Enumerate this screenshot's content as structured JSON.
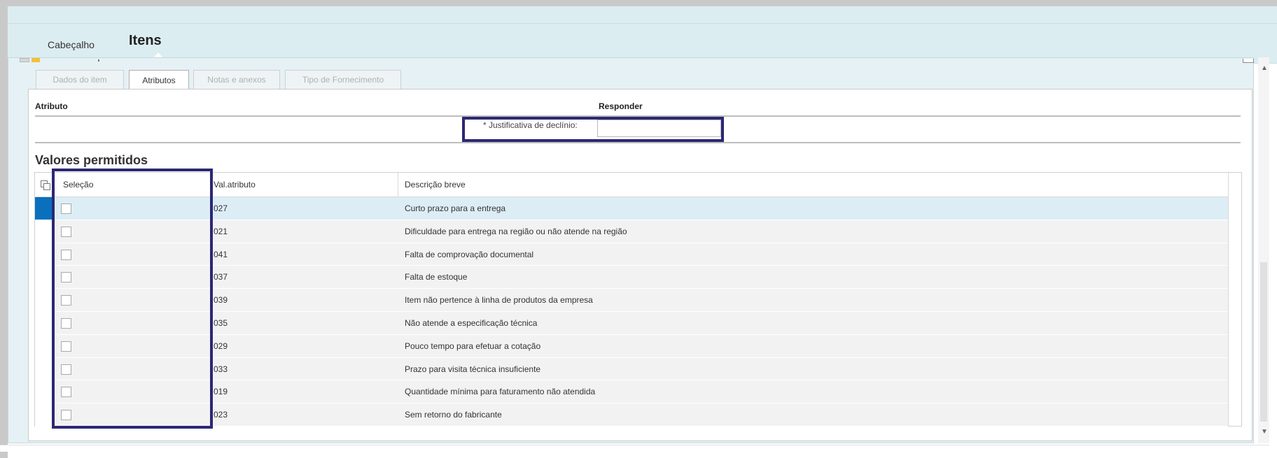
{
  "top_tabs": [
    {
      "label": "Cabeçalho",
      "active": false
    },
    {
      "label": "Itens",
      "active": true
    }
  ],
  "sub_tabs": [
    {
      "label": "Dados do item",
      "active": false
    },
    {
      "label": "Atributos",
      "active": true
    },
    {
      "label": "Notas e anexos",
      "active": false
    },
    {
      "label": "Tipo de Fornecimento",
      "active": false
    }
  ],
  "attributes": {
    "col_attribute": "Atributo",
    "col_respond": "Responder",
    "justification_label": "* Justificativa de declínio:",
    "justification_value": ""
  },
  "allowed_values": {
    "title": "Valores permitidos",
    "columns": [
      "Seleção",
      "Val.atributo",
      "Descrição breve"
    ],
    "rows": [
      {
        "value": "027",
        "description": "Curto prazo para a entrega",
        "selected_row": true,
        "checked": false
      },
      {
        "value": "021",
        "description": "Dificuldade para entrega na região ou não atende na região",
        "selected_row": false,
        "checked": false
      },
      {
        "value": "041",
        "description": "Falta de comprovação documental",
        "selected_row": false,
        "checked": false
      },
      {
        "value": "037",
        "description": "Falta de estoque",
        "selected_row": false,
        "checked": false
      },
      {
        "value": "039",
        "description": "Item não pertence à linha de produtos da empresa",
        "selected_row": false,
        "checked": false
      },
      {
        "value": "035",
        "description": "Não atende a especificação técnica",
        "selected_row": false,
        "checked": false
      },
      {
        "value": "029",
        "description": "Pouco tempo para efetuar a cotação",
        "selected_row": false,
        "checked": false
      },
      {
        "value": "033",
        "description": "Prazo para visita técnica insuficiente",
        "selected_row": false,
        "checked": false
      },
      {
        "value": "019",
        "description": "Quantidade mínima para faturamento não atendida",
        "selected_row": false,
        "checked": false
      },
      {
        "value": "023",
        "description": "Sem retorno do fabricante",
        "selected_row": false,
        "checked": false
      }
    ]
  },
  "colors": {
    "highlight_box": "#2b2875",
    "row_selected_marker": "#0a6fbd",
    "tab_bar_bg": "#dcedf1"
  },
  "icons": {
    "scroll_up": "▲",
    "scroll_down": "▼"
  }
}
